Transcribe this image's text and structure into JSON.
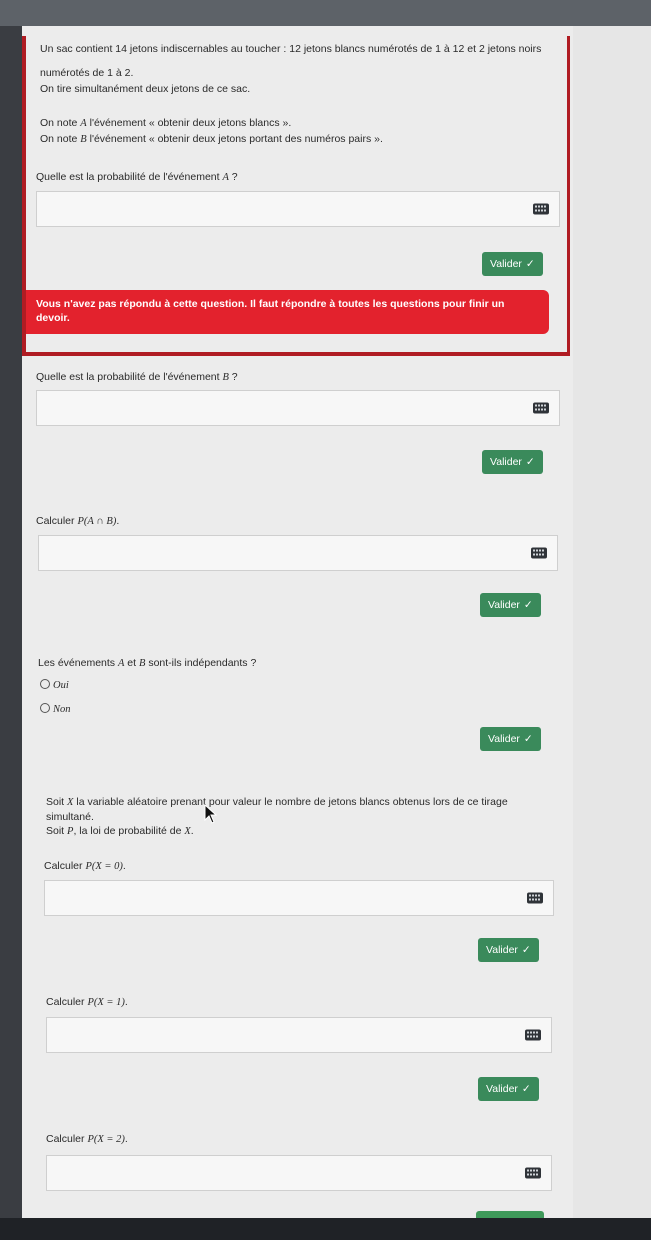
{
  "intro": {
    "line1": "Un sac contient 14 jetons indiscernables au toucher : 12 jetons blancs numérotés de 1 à 12 et 2 jetons noirs",
    "line2": "numérotés de 1 à 2.",
    "line3": "On tire simultanément deux jetons de ce sac.",
    "line4a": "On note ",
    "line4var": "A",
    "line4b": " l'événement « obtenir deux jetons blancs ».",
    "line5a": "On note ",
    "line5var": "B",
    "line5b": " l'événement « obtenir deux jetons portant des numéros pairs »."
  },
  "q1": {
    "label_a": "Quelle est la probabilité de l'événement ",
    "var": "A",
    "label_b": " ?",
    "value": ""
  },
  "q2": {
    "label_a": "Quelle est la probabilité de l'événement ",
    "var": "B",
    "label_b": " ?",
    "value": ""
  },
  "q3": {
    "label_a": "Calculer ",
    "expr": "P(A ∩ B)",
    "label_b": ".",
    "value": ""
  },
  "q4": {
    "label_a": "Les événements ",
    "varA": "A",
    "label_b": " et ",
    "varB": "B",
    "label_c": " sont-ils indépendants ?",
    "options": [
      "Oui",
      "Non"
    ]
  },
  "rv": {
    "line1a": "Soit ",
    "var": "X",
    "line1b": " la variable aléatoire prenant pour valeur le nombre de jetons blancs obtenus lors de ce tirage",
    "line2": "simultané.",
    "line3a": "Soit ",
    "varP": "P",
    "line3b": ", la loi de probabilité de ",
    "varX": "X",
    "line3c": "."
  },
  "q5": {
    "label_a": "Calculer ",
    "expr": "P(X = 0)",
    "label_b": ".",
    "value": ""
  },
  "q6": {
    "label_a": "Calculer ",
    "expr": "P(X = 1)",
    "label_b": ".",
    "value": ""
  },
  "q7": {
    "label_a": "Calculer ",
    "expr": "P(X = 2)",
    "label_b": ".",
    "value": ""
  },
  "validate_label": "Valider",
  "validate_icon": "✓",
  "alert": "Vous n'avez pas répondu à cette question. Il faut répondre à toutes les questions pour finir un devoir.",
  "colors": {
    "validate": "#3a8a5b",
    "alert": "#e3222d"
  }
}
